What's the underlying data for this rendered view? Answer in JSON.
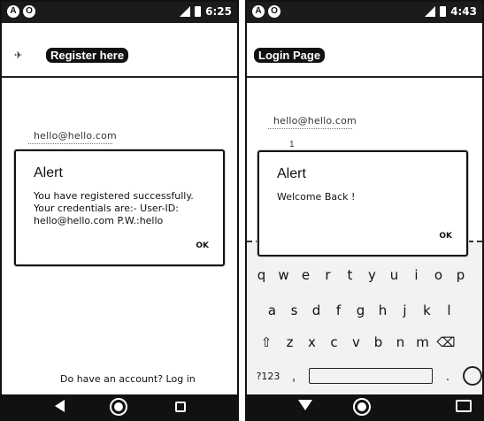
{
  "left": {
    "status": {
      "dots": [
        "A",
        "O"
      ],
      "time": "6:25"
    },
    "header": {
      "title": "Register here"
    },
    "field_value": "hello@hello.com",
    "alert": {
      "title": "Alert",
      "message": "You have registered successfully.\nYour credentials are:- User-ID:\nhello@hello.com P.W.:hello",
      "ok": "OK"
    },
    "bottom_link": "Do have an account? Log in"
  },
  "right": {
    "status": {
      "dots": [
        "A",
        "O"
      ],
      "time": "4:43"
    },
    "header": {
      "title": "Login Page"
    },
    "field_value": "hello@hello.com",
    "field_dash": "1",
    "alert": {
      "title": "Alert",
      "message": "Welcome Back !",
      "ok": "OK"
    },
    "keyboard": {
      "row1": [
        "q",
        "w",
        "e",
        "r",
        "t",
        "y",
        "u",
        "i",
        "o",
        "p"
      ],
      "row2": [
        "a",
        "s",
        "d",
        "f",
        "g",
        "h",
        "j",
        "k",
        "l"
      ],
      "row3": [
        "z",
        "x",
        "c",
        "v",
        "b",
        "n",
        "m"
      ],
      "sym_label": "?123",
      "comma": ",",
      "period": "."
    }
  }
}
